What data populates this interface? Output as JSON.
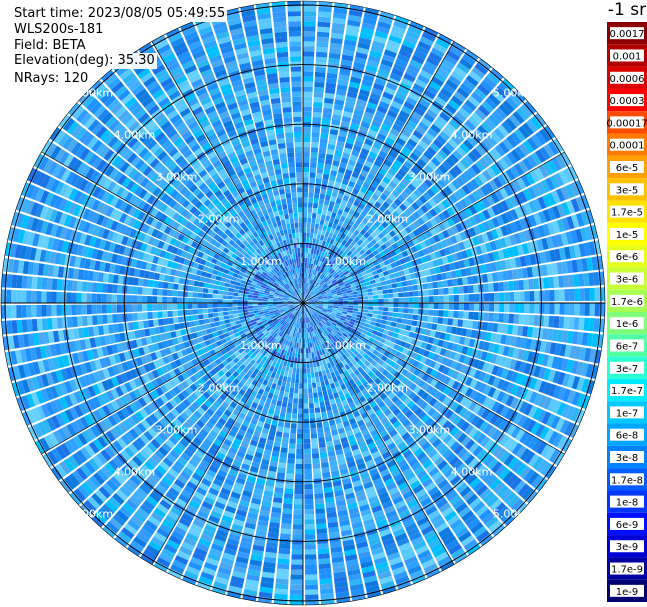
{
  "header": {
    "start_time": "Start time: 2023/08/05 05:49:55",
    "instrument": "WLS200s-181",
    "field": "Field: BETA",
    "elevation": "Elevation(deg): 35.30",
    "nrays": "NRays: 120"
  },
  "colorbar": {
    "title": "-1 sr",
    "labels": [
      "0.0017",
      "0.001",
      "0.0006",
      "0.0003",
      "0.00017",
      "0.0001",
      "6e-5",
      "3e-5",
      "1.7e-5",
      "1e-5",
      "6e-6",
      "3e-6",
      "1.7e-6",
      "1e-6",
      "6e-7",
      "3e-7",
      "1.7e-7",
      "1e-7",
      "6e-8",
      "3e-8",
      "1.7e-8",
      "1e-8",
      "6e-9",
      "3e-9",
      "1.7e-9",
      "1e-9"
    ],
    "colors": [
      "#8a0000",
      "#b00000",
      "#d80000",
      "#ff0000",
      "#ff4a00",
      "#ff7a00",
      "#ffa000",
      "#ffc000",
      "#ffe000",
      "#ffff00",
      "#e6ff1a",
      "#c8ff36",
      "#a6ff52",
      "#7dff7a",
      "#52ffa6",
      "#2cffd4",
      "#00ecff",
      "#00c8ff",
      "#00a6ff",
      "#0082ff",
      "#005cff",
      "#0036ff",
      "#0010ff",
      "#0000d4",
      "#0000a0",
      "#000070"
    ]
  },
  "chart_data": {
    "type": "heatmap",
    "projection": "polar PPI scan",
    "field": "BETA",
    "elevation_deg": 35.3,
    "n_rays": 120,
    "range_rings_km": [
      1.0,
      2.0,
      3.0,
      4.0,
      5.0
    ],
    "ring_labels": [
      "1.00km",
      "2.00km",
      "3.00km",
      "4.00km",
      "5.00km"
    ],
    "color_scale": "log",
    "color_range": [
      1e-09,
      0.0017
    ],
    "dominant_values": "approximately 3e-8 to 6e-7 (blue to cyan) across all ranges"
  }
}
